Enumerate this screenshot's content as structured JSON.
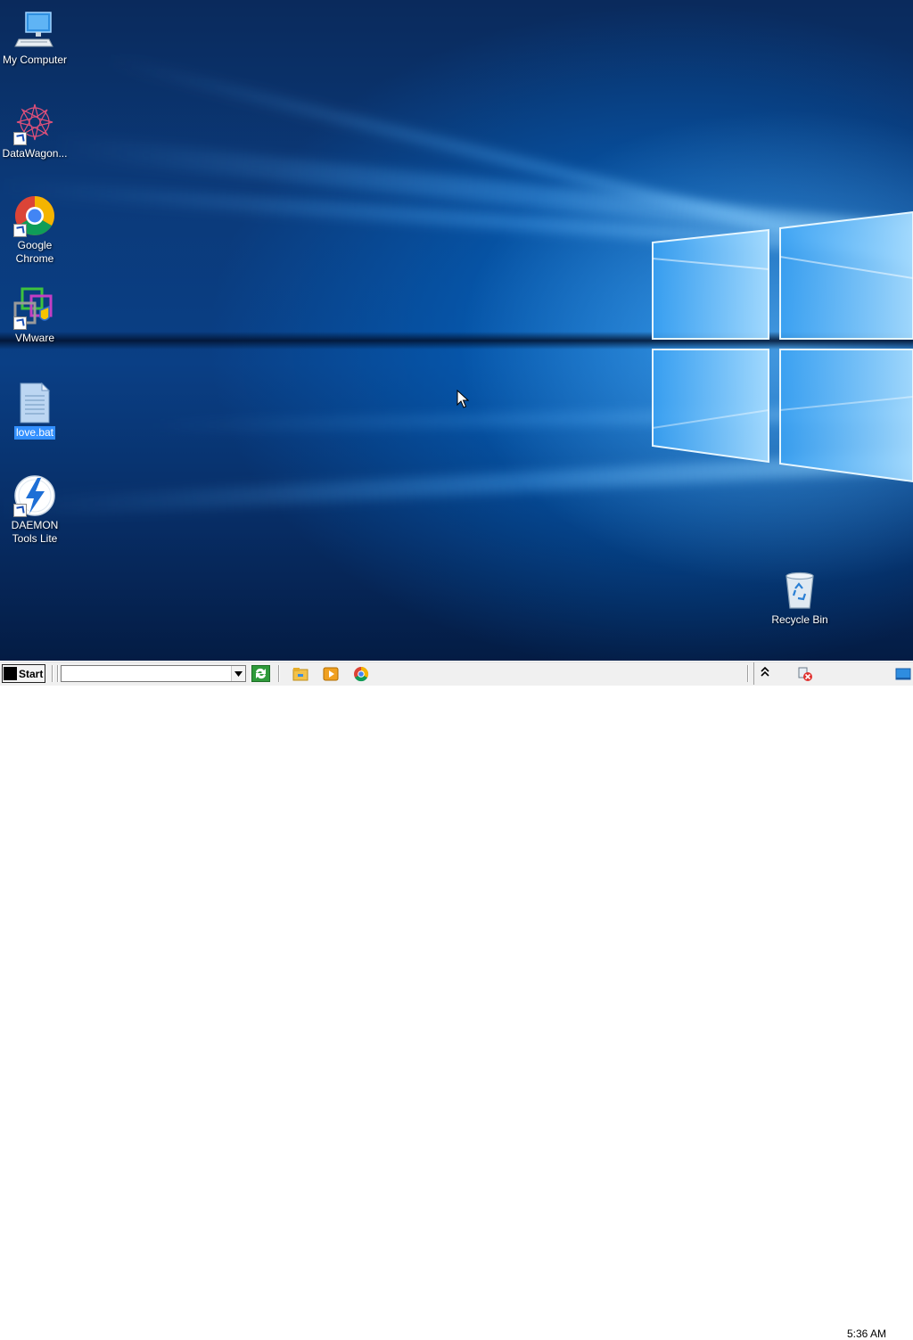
{
  "desktop": {
    "icons": [
      {
        "label": "My Computer",
        "icon": "computer-icon",
        "shortcut": false,
        "selected": false
      },
      {
        "label": "DataWagon...",
        "icon": "datawagon-icon",
        "shortcut": true,
        "selected": false
      },
      {
        "label": "Google Chrome",
        "icon": "chrome-icon",
        "shortcut": true,
        "selected": false
      },
      {
        "label": "VMware",
        "icon": "vmware-icon",
        "shortcut": true,
        "selected": false
      },
      {
        "label": "love.bat",
        "icon": "batch-file-icon",
        "shortcut": false,
        "selected": true
      },
      {
        "label": "DAEMON Tools Lite",
        "icon": "daemon-tools-icon",
        "shortcut": true,
        "selected": false
      },
      {
        "label": "Recycle Bin",
        "icon": "recycle-bin-icon",
        "shortcut": false,
        "selected": false
      }
    ]
  },
  "taskbar": {
    "start_label": "Start",
    "address_value": "",
    "quick_launch": [
      "file-explorer-icon",
      "media-player-icon",
      "chrome-icon"
    ],
    "clock": "5:36 AM"
  },
  "colors": {
    "selection": "#3390ff",
    "taskbar": "#f0f0f0",
    "wallpaper_accent": "#0078d7"
  }
}
